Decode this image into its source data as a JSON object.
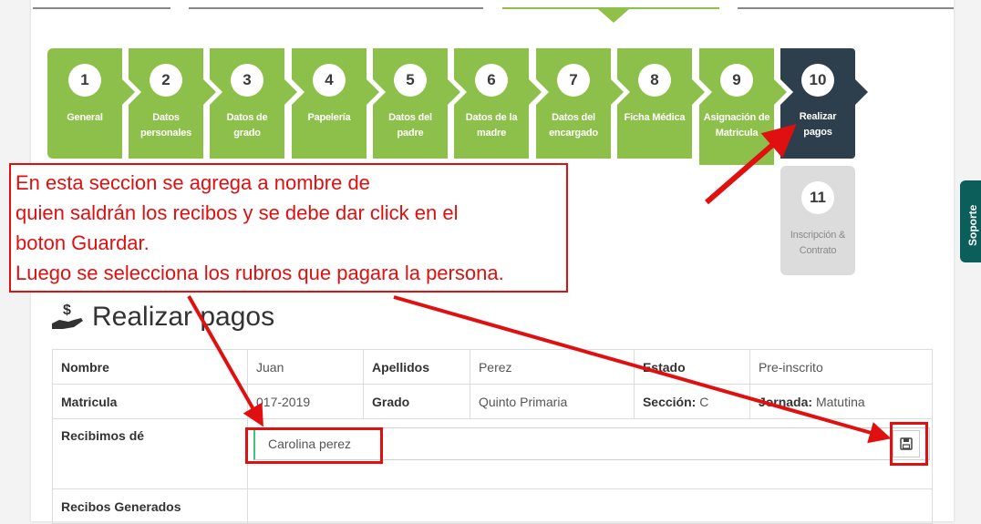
{
  "steps": [
    {
      "num": "1",
      "label": "General"
    },
    {
      "num": "2",
      "label": "Datos personales"
    },
    {
      "num": "3",
      "label": "Datos de grado"
    },
    {
      "num": "4",
      "label": "Papelería"
    },
    {
      "num": "5",
      "label": "Datos del padre"
    },
    {
      "num": "6",
      "label": "Datos de la madre"
    },
    {
      "num": "7",
      "label": "Datos del encargado"
    },
    {
      "num": "8",
      "label": "Ficha Médica"
    },
    {
      "num": "9",
      "label": "Asignación de Matricula"
    },
    {
      "num": "10",
      "label": "Realizar pagos"
    },
    {
      "num": "11",
      "label": "Inscripción & Contrato"
    }
  ],
  "annotation": {
    "lines": [
      "En esta seccion se agrega a nombre de",
      "quien saldrán los recibos y se debe dar click en el",
      "boton Guardar.",
      "Luego se selecciona los rubros que pagara la persona."
    ]
  },
  "page": {
    "title": "Realizar pagos",
    "icon": "hand-dollar-icon"
  },
  "info": {
    "nombre_label": "Nombre",
    "nombre": "Juan",
    "apellidos_label": "Apellidos",
    "apellidos": "Perez",
    "estado_label": "Estado",
    "estado": "Pre-inscrito",
    "matricula_label": "Matricula",
    "matricula": "017-2019",
    "grado_label": "Grado",
    "grado": "Quinto Primaria",
    "seccion_label": "Sección:",
    "seccion": "C",
    "jornada_label": "Jornada:",
    "jornada": "Matutina",
    "recibimos_label": "Recibimos dé",
    "recibimos_value": "Carolina perez",
    "recibos_label": "Recibos Generados"
  },
  "soporte": "Soporte",
  "colors": {
    "step": "#8dc04a",
    "active": "#2d3e4d",
    "inactive": "#dcdcdc",
    "annotation": "#e01010",
    "input_accent": "#3dc67a"
  }
}
